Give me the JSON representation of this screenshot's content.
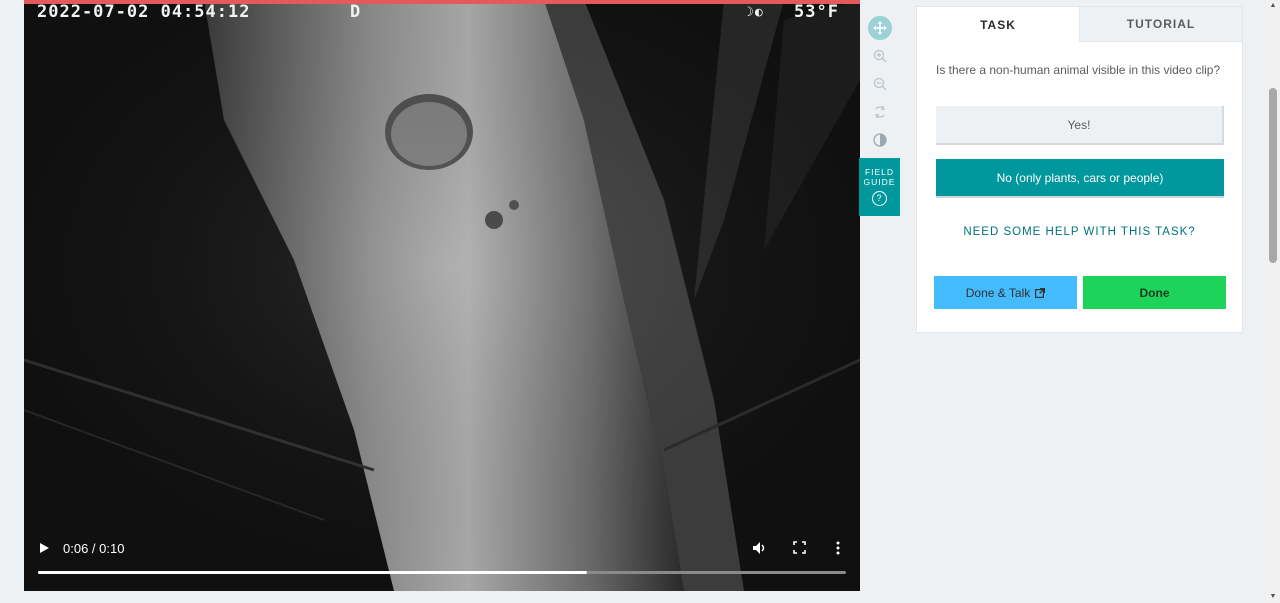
{
  "video": {
    "timestamp": "2022-07-02 04:54:12",
    "mode_letter": "D",
    "moon_icon": "moon-phase-icon",
    "temperature": "53°F",
    "time_display": "0:06 / 0:10",
    "progress": 0.68
  },
  "toolbar": {
    "tools": [
      "move-icon",
      "zoom-in-icon",
      "zoom-out-icon",
      "rotate-icon",
      "invert-icon"
    ],
    "field_guide_line1": "FIELD",
    "field_guide_line2": "GUIDE",
    "field_guide_icon": "?"
  },
  "panel": {
    "tabs": [
      {
        "label": "TASK",
        "active": true
      },
      {
        "label": "TUTORIAL",
        "active": false
      }
    ],
    "question": "Is there a non-human animal visible in this video clip?",
    "answers": [
      {
        "label": "Yes!"
      },
      {
        "label": "No (only plants, cars or people)"
      }
    ],
    "help_link": "NEED SOME HELP WITH THIS TASK?",
    "done_talk_label": "Done & Talk",
    "done_label": "Done"
  },
  "colors": {
    "accent_teal": "#00979d",
    "done_green": "#1ed359",
    "talk_blue": "#43bbfd",
    "recording_bar": "#e35a5a"
  }
}
